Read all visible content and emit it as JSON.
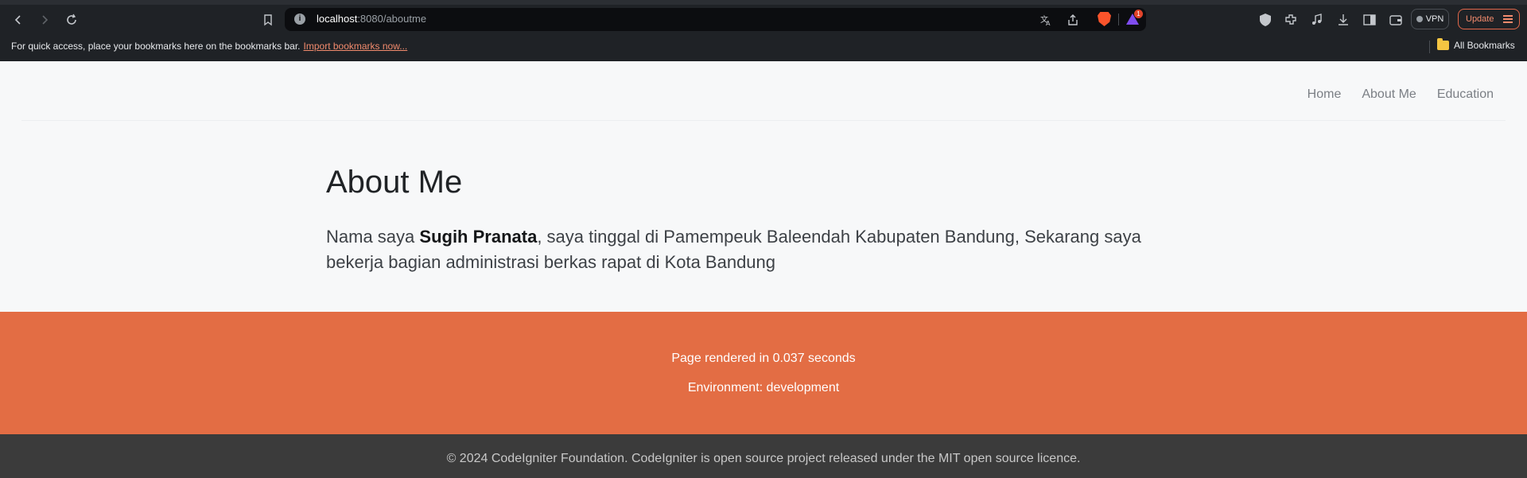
{
  "browser": {
    "url_host": "localhost",
    "url_path": ":8080/aboutme",
    "badge_count": "1",
    "vpn_label": "VPN",
    "update_label": "Update",
    "bookmarks_prompt": "For quick access, place your bookmarks here on the bookmarks bar.",
    "import_link": "Import bookmarks now...",
    "all_bookmarks": "All Bookmarks"
  },
  "nav": {
    "items": [
      "Home",
      "About Me",
      "Education"
    ]
  },
  "main": {
    "title": "About Me",
    "intro_before": "Nama saya ",
    "name": "Sugih Pranata",
    "intro_after": ", saya tinggal di Pamempeuk Baleendah Kabupaten Bandung, Sekarang saya bekerja bagian administrasi berkas rapat di Kota Bandung"
  },
  "footer": {
    "render_time": "Page rendered in 0.037 seconds",
    "environment": "Environment: development",
    "copyright": "© 2024 CodeIgniter Foundation. CodeIgniter is open source project released under the MIT open source licence."
  },
  "colors": {
    "accent_orange": "#e36d44",
    "footer_dark": "#3b3b3b",
    "browser_bg": "#1f2226"
  }
}
